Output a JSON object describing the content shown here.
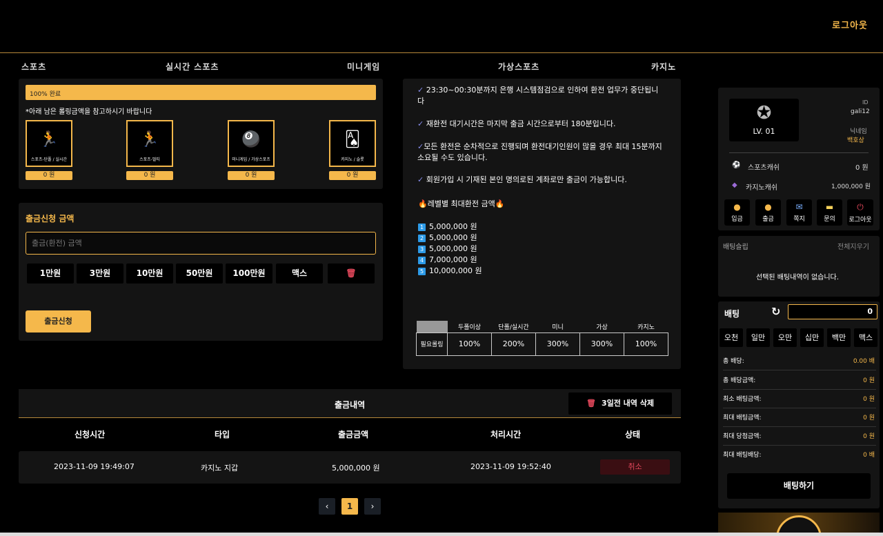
{
  "header": {
    "logout": "로그아웃"
  },
  "nav": [
    "스포츠",
    "실시간 스포츠",
    "미니게임",
    "가상스포츠",
    "카지노"
  ],
  "rolling": {
    "progress_label": "100% 완료",
    "progress_pct": 100,
    "notice": "*아래 남은 롤링금액을 참고하시기 바랍니다",
    "wallets": [
      {
        "icon": "runner-icon",
        "label": "스포츠-단폴 / 실시간",
        "amount": "0 원"
      },
      {
        "icon": "runner-icon",
        "label": "스포츠-멀티",
        "amount": "0 원"
      },
      {
        "icon": "billiard-ball-icon",
        "label": "미니게임 / 가상스포츠",
        "amount": "0 원"
      },
      {
        "icon": "cards-icon",
        "label": "카지노 / 슬롯",
        "amount": "0 원"
      }
    ]
  },
  "withdraw": {
    "title": "출금신청 금액",
    "placeholder": "출금(환전) 금액",
    "amounts": [
      "1만원",
      "3만원",
      "10만원",
      "50만원",
      "100만원",
      "맥스"
    ],
    "submit": "출금신청"
  },
  "info": {
    "lines": [
      "23:30~00:30분까지 은행 시스템점검으로 인하여 환전 업무가 중단됩니다",
      "재환전 대기시간은 마지막 출금 시간으로부터 180분입니다.",
      "모든 환전은 순차적으로 진행되며 환전대기인원이 많을 경우 최대 15분까지 소요될 수도 있습니다.",
      "회원가입 시 기재된 본인 명의로된 계좌로만 출금이 가능합니다."
    ],
    "level_title": "레벨별 최대환전 금액",
    "levels": [
      {
        "num": "1",
        "amount": "5,000,000 원"
      },
      {
        "num": "2",
        "amount": "5,000,000 원"
      },
      {
        "num": "3",
        "amount": "5,000,000 원"
      },
      {
        "num": "4",
        "amount": "7,000,000 원"
      },
      {
        "num": "5",
        "amount": "10,000,000 원"
      }
    ],
    "rolling_table": {
      "headers": [
        "두폴이상",
        "단폴/실시간",
        "미니",
        "가상",
        "카지노"
      ],
      "row_label": "필요롤링",
      "values": [
        "100%",
        "200%",
        "300%",
        "300%",
        "100%"
      ]
    }
  },
  "history": {
    "title": "출금내역",
    "delete_label": "3일전 내역 삭제",
    "columns": [
      "신청시간",
      "타입",
      "출금금액",
      "처리시간",
      "상태"
    ],
    "rows": [
      {
        "requested": "2023-11-09 19:49:07",
        "type": "카지노 지갑",
        "amount": "5,000,000 원",
        "processed": "2023-11-09 19:52:40",
        "status": "취소"
      }
    ],
    "pagination": {
      "prev": "‹",
      "current": "1",
      "next": "›"
    }
  },
  "profile": {
    "level": "LV. 01",
    "id_label": "ID",
    "id_value": "gali12",
    "nick_label": "닉네임",
    "nick_value": "백호상",
    "sports_cash_label": "스포츠캐쉬",
    "sports_cash_value": "0 원",
    "casino_cash_label": "카지노캐쉬",
    "casino_cash_value": "1,000,000 원",
    "quick": [
      {
        "icon": "deposit-icon",
        "label": "입금"
      },
      {
        "icon": "withdraw-icon",
        "label": "출금"
      },
      {
        "icon": "message-icon",
        "label": "쪽지"
      },
      {
        "icon": "inquiry-icon",
        "label": "문의"
      },
      {
        "icon": "power-icon",
        "label": "로그아웃"
      }
    ]
  },
  "betslip": {
    "title": "배팅슬립",
    "clear_all": "전체지우기",
    "empty": "선택된 배팅내역이 없습니다.",
    "bet_label": "배팅",
    "bet_value": "0",
    "chips": [
      "오천",
      "일만",
      "오만",
      "십만",
      "백만",
      "맥스"
    ],
    "summary": [
      {
        "label": "총 배당:",
        "value": "0.00 배"
      },
      {
        "label": "총 배당금액:",
        "value": "0 원"
      },
      {
        "label": "최소 배팅금액:",
        "value": "0 원"
      },
      {
        "label": "최대 배팅금액:",
        "value": "0 원"
      },
      {
        "label": "최대 당첨금액:",
        "value": "0 원"
      },
      {
        "label": "최대 배팅배당:",
        "value": "0 배"
      }
    ],
    "submit": "배팅하기"
  },
  "colors": {
    "accent": "#f5b84b",
    "panel": "#141414",
    "background": "#000000",
    "danger": "#e0475a"
  }
}
